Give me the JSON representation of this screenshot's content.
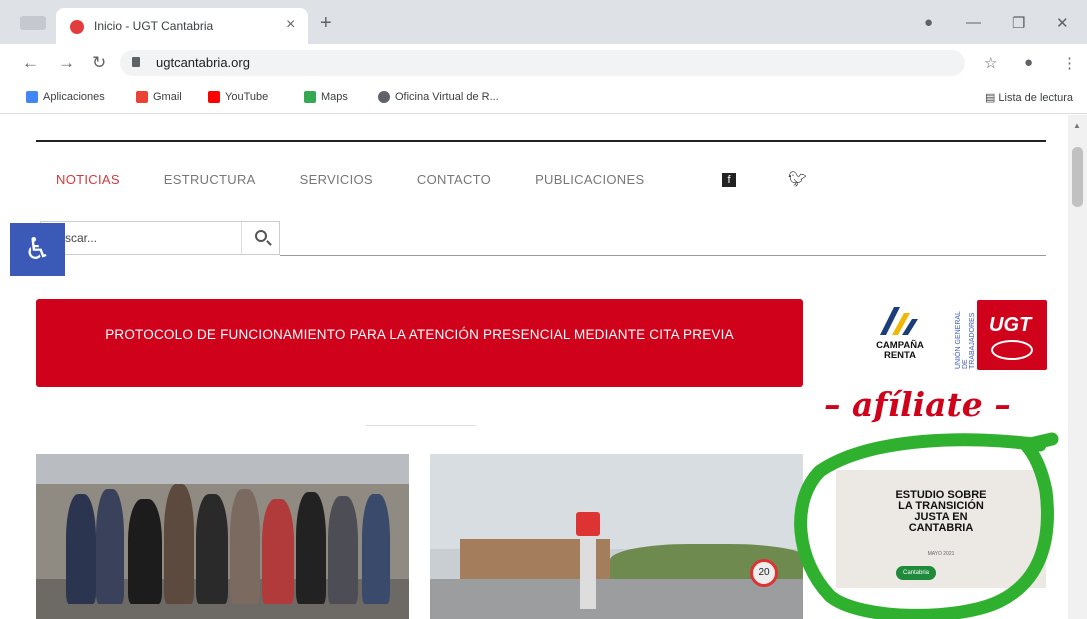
{
  "browser": {
    "tab_title": "Inicio - UGT Cantabria",
    "tab_close": "×",
    "new_tab": "+",
    "url": "ugtcantabria.org",
    "reading_list": "Lista de lectura",
    "bookmarks": [
      {
        "label": "Aplicaciones",
        "color": "#ea4335"
      },
      {
        "label": "Gmail",
        "color": "#ea4335"
      },
      {
        "label": "YouTube",
        "color": "#ff0000"
      },
      {
        "label": "Maps",
        "color": "#34a853"
      },
      {
        "label": "Oficina Virtual de R...",
        "color": "#5f6368"
      }
    ]
  },
  "site": {
    "nav": [
      "NOTICIAS",
      "ESTRUCTURA",
      "SERVICIOS",
      "CONTACTO",
      "PUBLICACIONES"
    ],
    "search_value": "scar...",
    "banner": "PROTOCOLO DE FUNCIONAMIENTO PARA LA ATENCIÓN PRESENCIAL MEDIANTE CITA PREVIA",
    "campana": "CAMPAÑA RENTA",
    "ugt": "UGT",
    "ugt_vertical": "UNIÓN GENERAL DE TRABAJADORES",
    "afiliate": "– afíliate –",
    "study_title_lines": [
      "ESTUDIO SOBRE",
      "LA TRANSICIÓN",
      "JUSTA EN",
      "CANTABRIA"
    ],
    "study_sub": "MAYO 2021",
    "study_badge": "Cantabria",
    "speed_sign": "20"
  },
  "colors": {
    "accent_red": "#d0021b",
    "nav_active": "#d23a3a",
    "a11y_blue": "#3b5ab8",
    "annotation_green": "#2fb12f"
  }
}
